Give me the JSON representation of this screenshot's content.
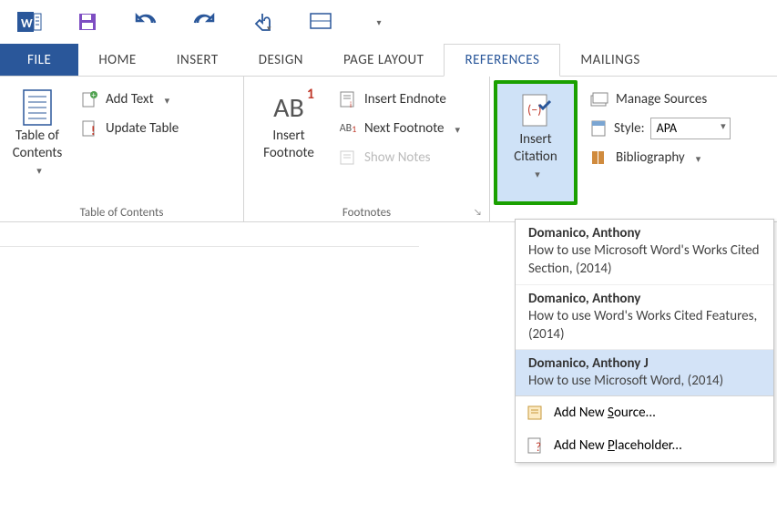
{
  "qat_icons": [
    "word-icon",
    "save-icon",
    "undo-icon",
    "redo-icon",
    "touch-mode-icon",
    "page-width-icon",
    "customize-icon"
  ],
  "tabs": {
    "file": "FILE",
    "home": "HOME",
    "insert": "INSERT",
    "design": "DESIGN",
    "page_layout": "PAGE LAYOUT",
    "references": "REFERENCES",
    "mailings": "MAILINGS"
  },
  "toc_group": {
    "label": "Table of Contents",
    "table_of_contents": "Table of\nContents",
    "add_text": "Add Text",
    "update_table": "Update Table"
  },
  "footnotes_group": {
    "label": "Footnotes",
    "insert_footnote": "Insert\nFootnote",
    "footnote_glyph": "AB",
    "footnote_super": "1",
    "insert_endnote": "Insert Endnote",
    "next_footnote": "Next Footnote",
    "show_notes": "Show Notes"
  },
  "citations_group": {
    "insert_citation": "Insert\nCitation",
    "manage_sources": "Manage Sources",
    "style_label": "Style:",
    "style_value": "APA",
    "bibliography": "Bibliography"
  },
  "citation_menu": {
    "items": [
      {
        "author": "Domanico, Anthony",
        "title": "How to use Microsoft Word's Works Cited Section, (2014)",
        "hl": false
      },
      {
        "author": "Domanico, Anthony",
        "title": "How to use Word's Works Cited Features, (2014)",
        "hl": false
      },
      {
        "author": "Domanico, Anthony J",
        "title": "How to use Microsoft Word, (2014)",
        "hl": true
      }
    ],
    "add_source_pre": "Add New ",
    "add_source_u": "S",
    "add_source_post": "ource...",
    "add_placeholder_pre": "Add New ",
    "add_placeholder_u": "P",
    "add_placeholder_post": "laceholder..."
  }
}
